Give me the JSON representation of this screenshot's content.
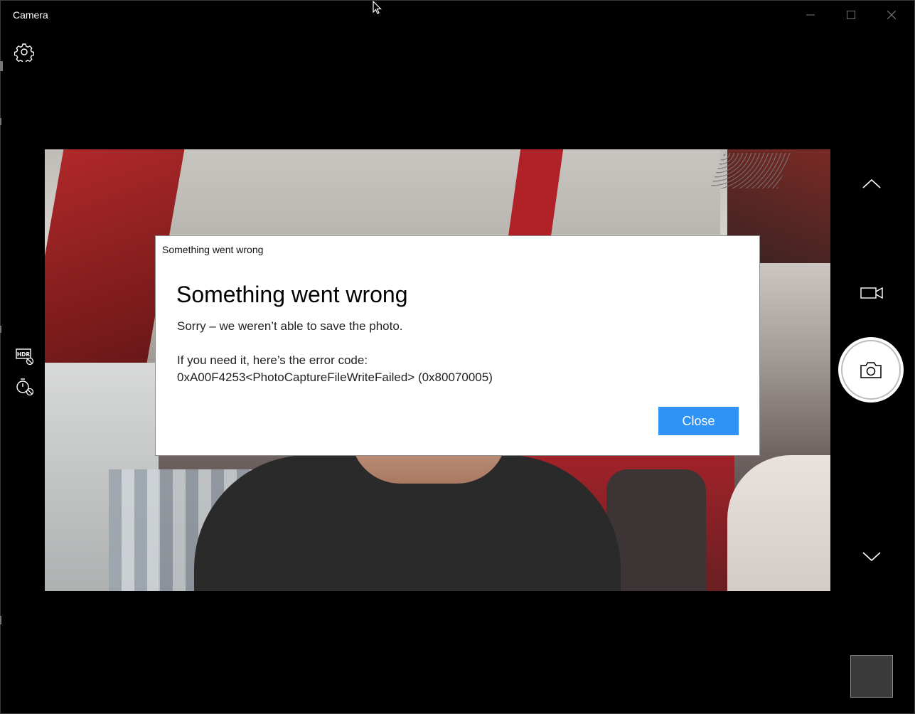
{
  "window": {
    "title": "Camera",
    "controls": {
      "minimize": "minimize-icon",
      "maximize": "maximize-icon",
      "close": "close-icon"
    }
  },
  "left_toolbar": {
    "settings_icon": "gear-icon",
    "hdr_icon": "hdr-off-icon",
    "timer_icon": "timer-off-icon"
  },
  "right_toolbar": {
    "up_icon": "chevron-up-icon",
    "video_mode_icon": "video-camera-icon",
    "shutter_icon": "camera-icon",
    "down_icon": "chevron-down-icon",
    "gallery_thumbnail": "last-photo-thumbnail"
  },
  "dialog": {
    "caption": "Something went wrong",
    "heading": "Something went wrong",
    "message": "Sorry – we weren’t able to save the photo.",
    "code_label": "If you need it, here’s the error code:",
    "code": "0xA00F4253<PhotoCaptureFileWriteFailed> (0x80070005)",
    "close_label": "Close"
  },
  "colors": {
    "background": "#000000",
    "accent": "#2f93f5",
    "dialog_bg": "#ffffff"
  }
}
